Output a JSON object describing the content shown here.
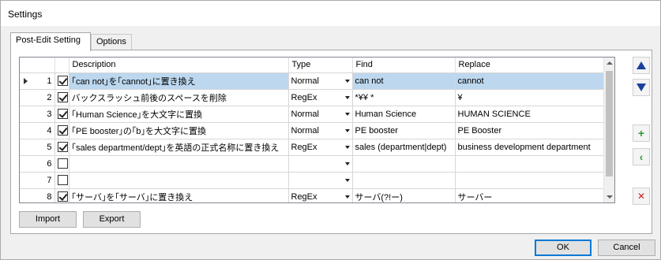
{
  "window": {
    "title": "Settings"
  },
  "tabs": [
    {
      "label": "Post-Edit Setting",
      "active": true
    },
    {
      "label": "Options",
      "active": false
    }
  ],
  "grid": {
    "columns": [
      "Description",
      "Type",
      "Find",
      "Replace"
    ],
    "rows": [
      {
        "num": "1",
        "checked": true,
        "description": "｢can not｣を｢cannot｣に置き換え",
        "type": "Normal",
        "find": "can not",
        "replace": "cannot",
        "selected": true
      },
      {
        "num": "2",
        "checked": true,
        "description": "バックスラッシュ前後のスペースを削除",
        "type": "RegEx",
        "find": " *¥¥ *",
        "replace": "¥",
        "selected": false
      },
      {
        "num": "3",
        "checked": true,
        "description": "｢Human Science｣を大文字に置換",
        "type": "Normal",
        "find": "Human Science",
        "replace": "HUMAN SCIENCE",
        "selected": false
      },
      {
        "num": "4",
        "checked": true,
        "description": "｢PE booster｣の｢b｣を大文字に置換",
        "type": "Normal",
        "find": "PE booster",
        "replace": "PE Booster",
        "selected": false
      },
      {
        "num": "5",
        "checked": true,
        "description": "｢sales department/dept｣を英語の正式名称に置き換え",
        "type": "RegEx",
        "find": "sales (department|dept)",
        "replace": "business development department",
        "selected": false
      },
      {
        "num": "6",
        "checked": false,
        "description": "",
        "type": "",
        "find": "",
        "replace": "",
        "selected": false
      },
      {
        "num": "7",
        "checked": false,
        "description": "",
        "type": "",
        "find": "",
        "replace": "",
        "selected": false
      },
      {
        "num": "8",
        "checked": true,
        "description": "｢サーバ｣を｢サーバ｣に置き換え",
        "type": "RegEx",
        "find": "サーバ(?!ー)",
        "replace": "サーバー",
        "selected": false
      }
    ]
  },
  "side_buttons": {
    "move_up_icon": "triangle-up",
    "move_down_icon": "triangle-down",
    "add_glyph": "+",
    "insert_glyph": "‹",
    "delete_glyph": "✕",
    "add_color": "#2e9b2e",
    "delete_color": "#d02020",
    "arrow_color": "#1b3f9c"
  },
  "buttons": {
    "import": "Import",
    "export": "Export",
    "ok": "OK",
    "cancel": "Cancel"
  }
}
